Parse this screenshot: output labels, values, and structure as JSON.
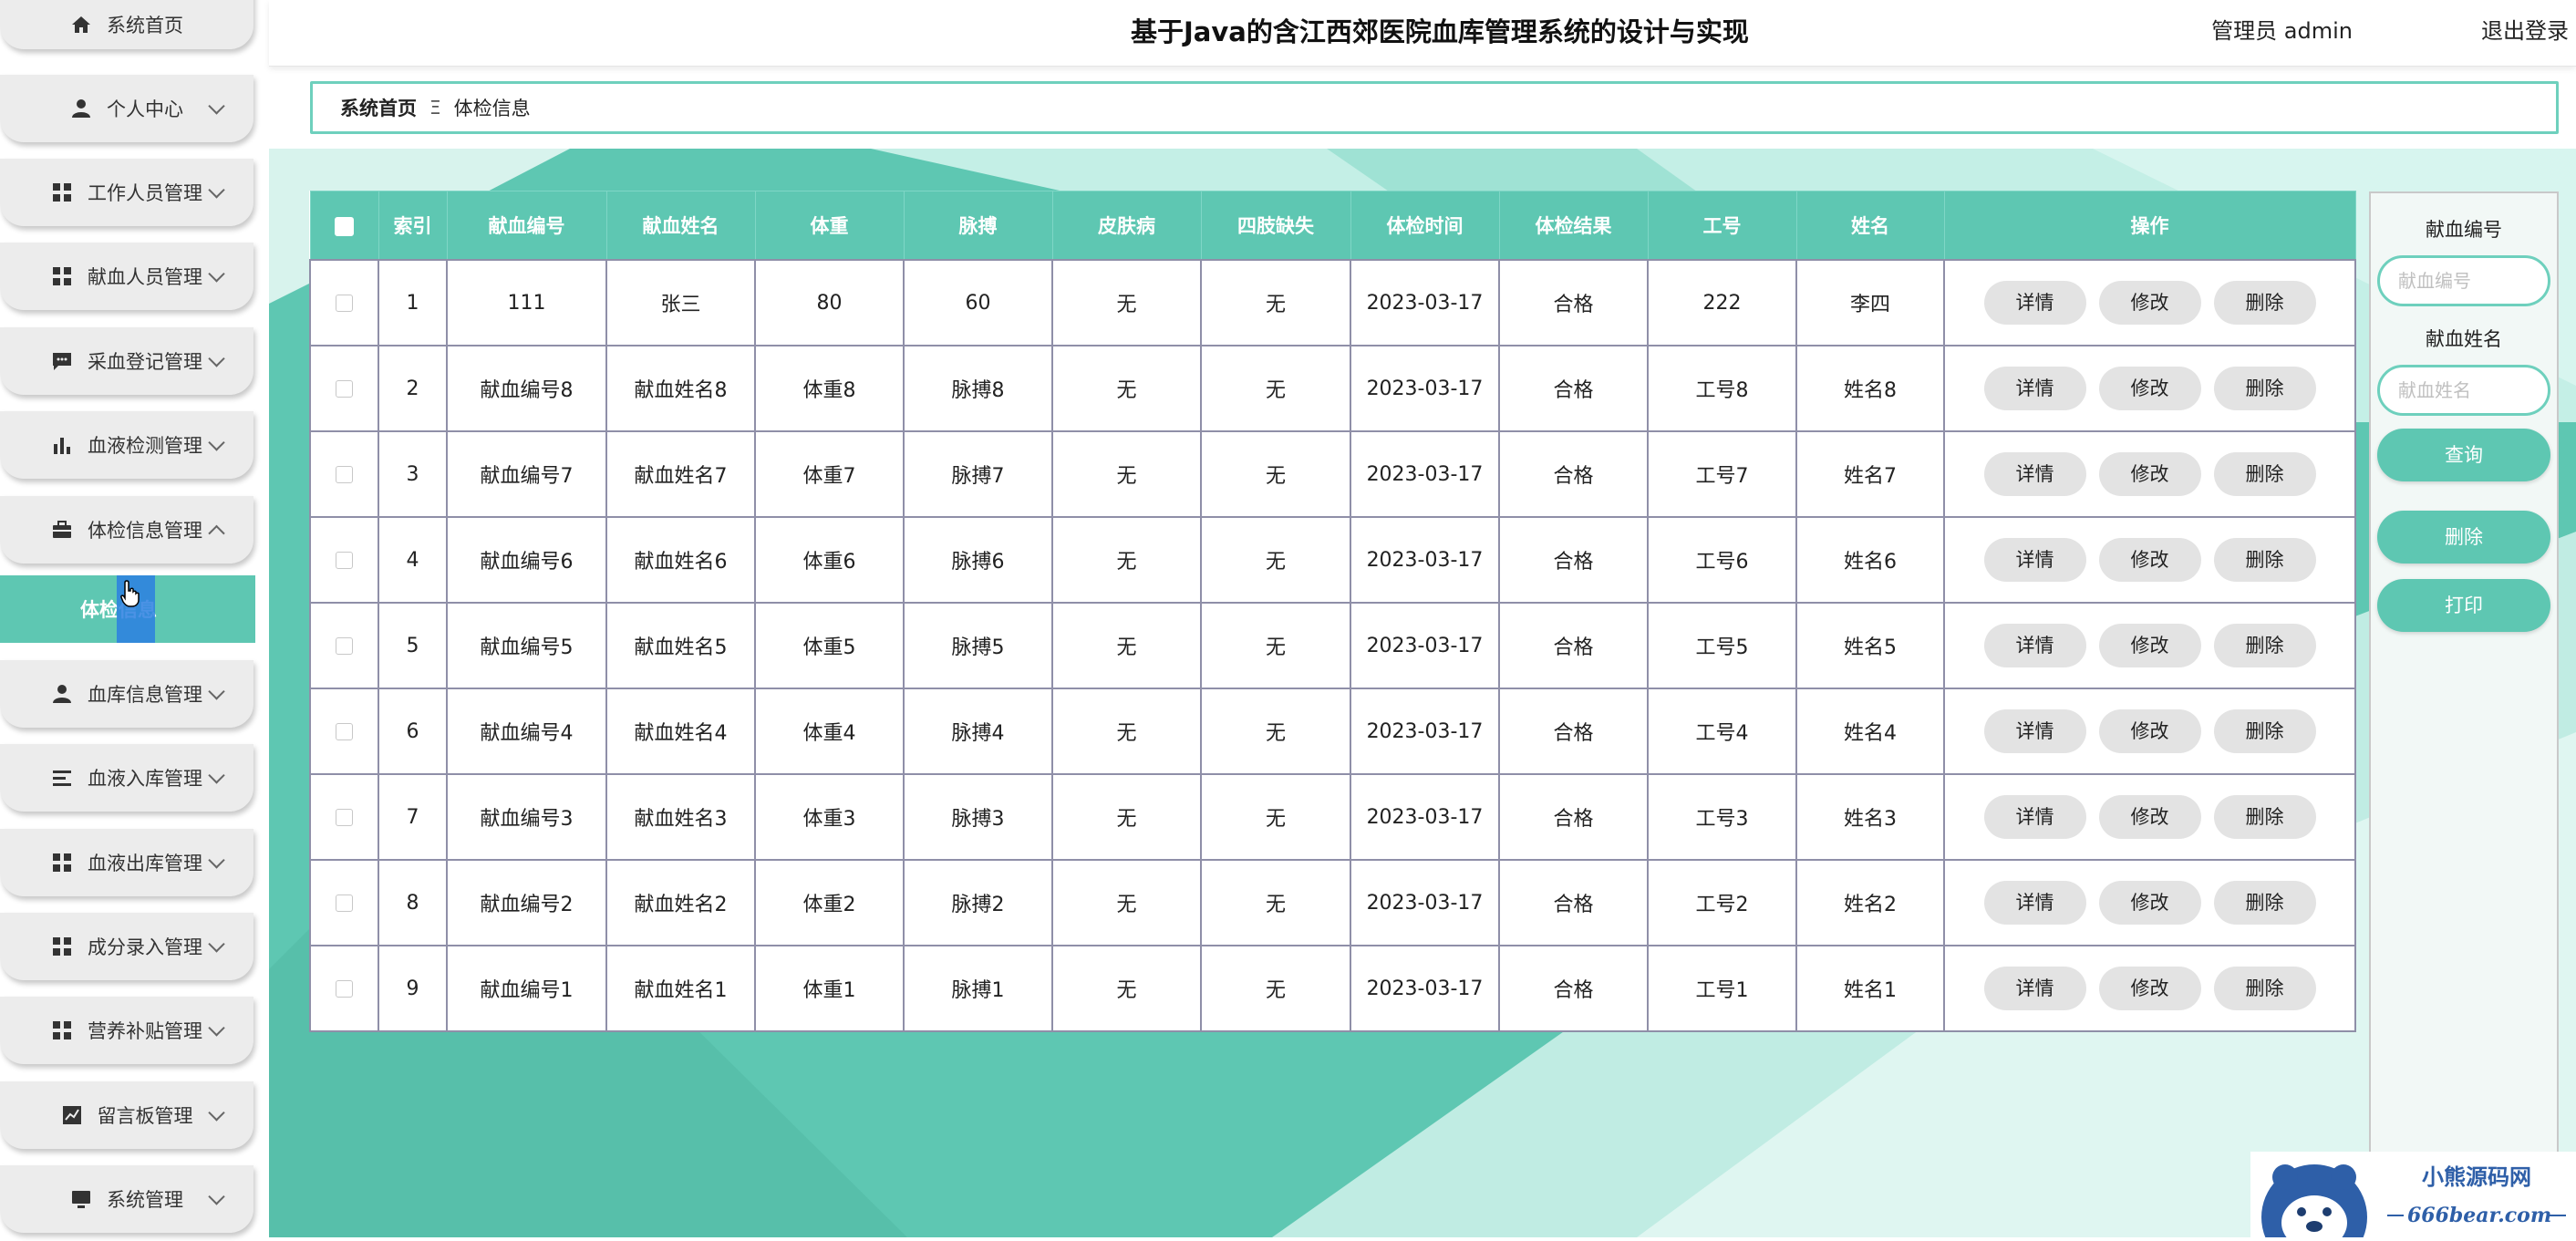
{
  "sidebar": {
    "items": [
      {
        "label": "系统首页",
        "icon": "home-icon",
        "expanded": null
      },
      {
        "label": "个人中心",
        "icon": "user-icon",
        "expanded": false
      },
      {
        "label": "工作人员管理",
        "icon": "grid-icon",
        "expanded": false
      },
      {
        "label": "献血人员管理",
        "icon": "grid-icon",
        "expanded": false
      },
      {
        "label": "采血登记管理",
        "icon": "chat-icon",
        "expanded": false
      },
      {
        "label": "血液检测管理",
        "icon": "bar-chart-icon",
        "expanded": false
      },
      {
        "label": "体检信息管理",
        "icon": "briefcase-icon",
        "expanded": true
      },
      {
        "label": "血库信息管理",
        "icon": "user-icon",
        "expanded": false
      },
      {
        "label": "血液入库管理",
        "icon": "list-icon",
        "expanded": false
      },
      {
        "label": "血液出库管理",
        "icon": "grid-icon",
        "expanded": false
      },
      {
        "label": "成分录入管理",
        "icon": "grid-icon",
        "expanded": false
      },
      {
        "label": "营养补贴管理",
        "icon": "grid-icon",
        "expanded": false
      },
      {
        "label": "留言板管理",
        "icon": "line-chart-icon",
        "expanded": false
      },
      {
        "label": "系统管理",
        "icon": "monitor-icon",
        "expanded": false
      }
    ],
    "submenu": {
      "label": "体检信息"
    }
  },
  "header": {
    "title": "基于Java的含江西郊医院血库管理系统的设计与实现",
    "user": "管理员 admin",
    "logout": "退出登录"
  },
  "breadcrumb": {
    "home": "系统首页",
    "separator": "Ξ",
    "current": "体检信息"
  },
  "table": {
    "columns": [
      "索引",
      "献血编号",
      "献血姓名",
      "体重",
      "脉搏",
      "皮肤病",
      "四肢缺失",
      "体检时间",
      "体检结果",
      "工号",
      "姓名",
      "操作"
    ],
    "rows": [
      [
        "1",
        "111",
        "张三",
        "80",
        "60",
        "无",
        "无",
        "2023-03-17",
        "合格",
        "222",
        "李四"
      ],
      [
        "2",
        "献血编号8",
        "献血姓名8",
        "体重8",
        "脉搏8",
        "无",
        "无",
        "2023-03-17",
        "合格",
        "工号8",
        "姓名8"
      ],
      [
        "3",
        "献血编号7",
        "献血姓名7",
        "体重7",
        "脉搏7",
        "无",
        "无",
        "2023-03-17",
        "合格",
        "工号7",
        "姓名7"
      ],
      [
        "4",
        "献血编号6",
        "献血姓名6",
        "体重6",
        "脉搏6",
        "无",
        "无",
        "2023-03-17",
        "合格",
        "工号6",
        "姓名6"
      ],
      [
        "5",
        "献血编号5",
        "献血姓名5",
        "体重5",
        "脉搏5",
        "无",
        "无",
        "2023-03-17",
        "合格",
        "工号5",
        "姓名5"
      ],
      [
        "6",
        "献血编号4",
        "献血姓名4",
        "体重4",
        "脉搏4",
        "无",
        "无",
        "2023-03-17",
        "合格",
        "工号4",
        "姓名4"
      ],
      [
        "7",
        "献血编号3",
        "献血姓名3",
        "体重3",
        "脉搏3",
        "无",
        "无",
        "2023-03-17",
        "合格",
        "工号3",
        "姓名3"
      ],
      [
        "8",
        "献血编号2",
        "献血姓名2",
        "体重2",
        "脉搏2",
        "无",
        "无",
        "2023-03-17",
        "合格",
        "工号2",
        "姓名2"
      ],
      [
        "9",
        "献血编号1",
        "献血姓名1",
        "体重1",
        "脉搏1",
        "无",
        "无",
        "2023-03-17",
        "合格",
        "工号1",
        "姓名1"
      ]
    ],
    "actions": {
      "detail": "详情",
      "edit": "修改",
      "delete": "删除"
    }
  },
  "search": {
    "field1_label": "献血编号",
    "field1_placeholder": "献血编号",
    "field2_label": "献血姓名",
    "field2_placeholder": "献血姓名",
    "query": "查询",
    "delete": "删除",
    "print": "打印"
  },
  "watermark": {
    "brand": "小熊源码网",
    "site": "666bear.com"
  },
  "colors": {
    "accent": "#5ec7b2",
    "accent_border": "#6ed0bd",
    "button_gray": "#e3e3e3",
    "sidebar_item": "#ececec"
  }
}
